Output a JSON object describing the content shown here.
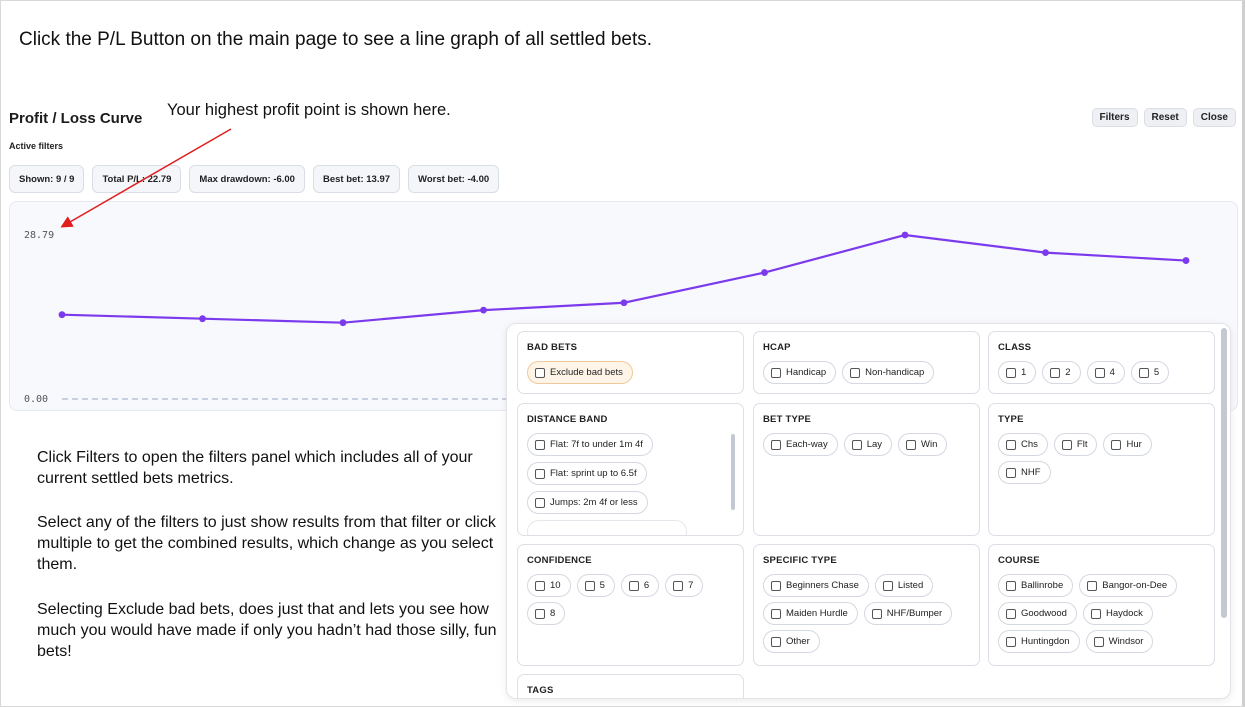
{
  "instructions": {
    "top": "Click the P/L Button on the main page to see a line graph of all settled bets.",
    "highest_point": "Your highest profit point is shown here.",
    "filters_help": "Click Filters to open the filters panel which includes all of your current settled bets metrics.",
    "select_help": "Select any of the filters to just show results from that filter or click multiple to get the combined results, which change as you select them.",
    "exclude_help": "Selecting Exclude bad bets, does just that and lets you see how much you would have made if only you hadn’t had those silly, fun bets!"
  },
  "header": {
    "title": "Profit / Loss Curve",
    "buttons": {
      "filters": "Filters",
      "reset": "Reset",
      "close": "Close"
    }
  },
  "active_filters_label": "Active filters",
  "stats": {
    "shown": "Shown: 9 / 9",
    "total_pl": "Total P/L: 22.79",
    "max_drawdown": "Max drawdown: -6.00",
    "best_bet": "Best bet: 13.97",
    "worst_bet": "Worst bet: -4.00"
  },
  "chart_data": {
    "type": "line",
    "title": "",
    "xlabel": "",
    "ylabel": "",
    "y_tick_labels": [
      "28.79",
      "0.00"
    ],
    "ylim": [
      0,
      28.79
    ],
    "line_color": "#7c3aed",
    "baseline_dashed": true,
    "series": [
      {
        "values": [
          14.8,
          14.1,
          13.4,
          15.6,
          16.9,
          22.2,
          28.79,
          25.7,
          24.3
        ]
      }
    ]
  },
  "filters": {
    "bad_bets": {
      "title": "BAD BETS",
      "options": [
        "Exclude bad bets"
      ]
    },
    "hcap": {
      "title": "HCAP",
      "options": [
        "Handicap",
        "Non-handicap"
      ]
    },
    "class": {
      "title": "CLASS",
      "options": [
        "1",
        "2",
        "4",
        "5"
      ]
    },
    "distance_band": {
      "title": "DISTANCE BAND",
      "options": [
        "Flat: 7f to under 1m 4f",
        "Flat: sprint up to 6.5f",
        "Jumps: 2m 4f or less"
      ]
    },
    "bet_type": {
      "title": "BET TYPE",
      "options": [
        "Each-way",
        "Lay",
        "Win"
      ]
    },
    "type": {
      "title": "TYPE",
      "options": [
        "Chs",
        "Flt",
        "Hur",
        "NHF"
      ]
    },
    "confidence": {
      "title": "CONFIDENCE",
      "options": [
        "10",
        "5",
        "6",
        "7",
        "8"
      ]
    },
    "specific_type": {
      "title": "SPECIFIC TYPE",
      "options": [
        "Beginners Chase",
        "Listed",
        "Maiden Hurdle",
        "NHF/Bumper",
        "Other"
      ]
    },
    "course": {
      "title": "COURSE",
      "options": [
        "Ballinrobe",
        "Bangor-on-Dee",
        "Goodwood",
        "Haydock",
        "Huntingdon",
        "Windsor"
      ]
    },
    "tags": {
      "title": "TAGS"
    }
  }
}
